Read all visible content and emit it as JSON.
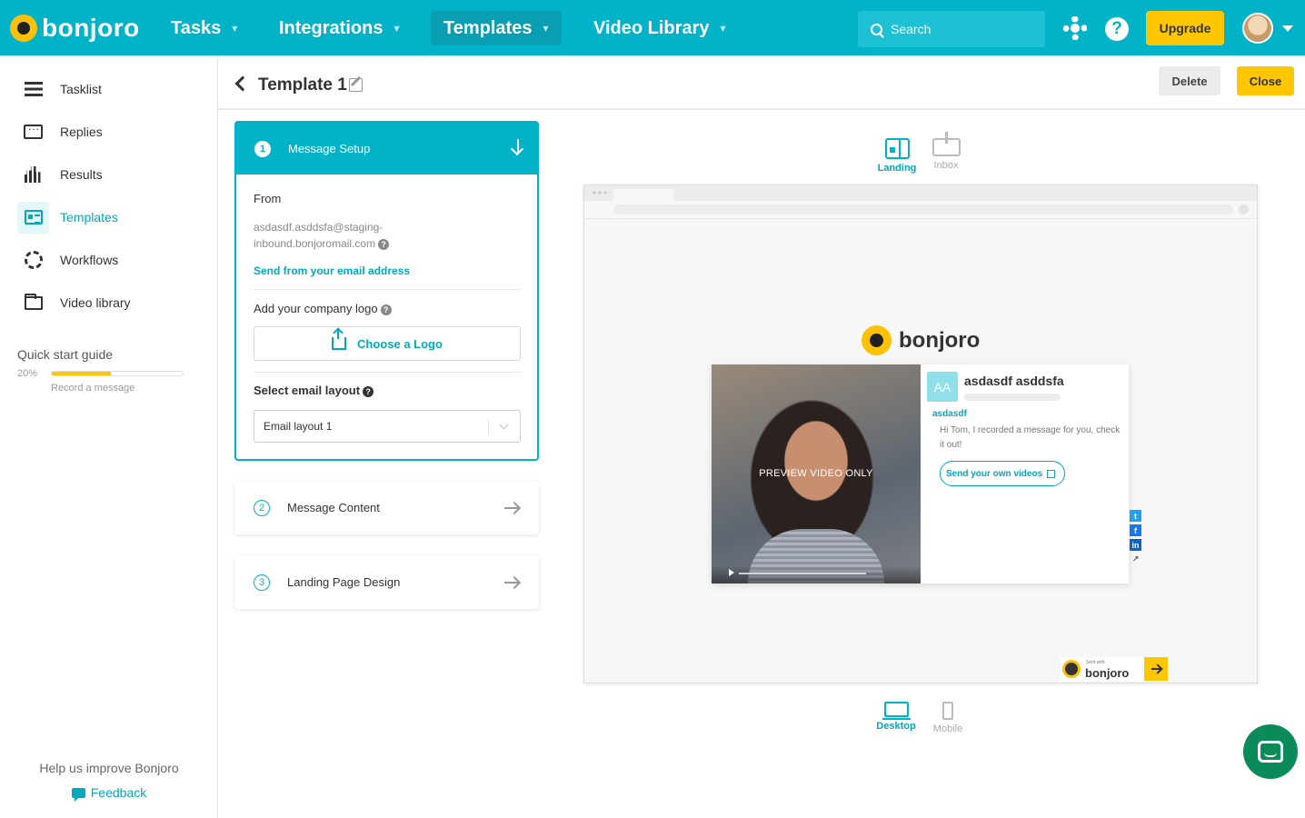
{
  "nav": {
    "brand": "bonjoro",
    "items": [
      {
        "label": "Tasks"
      },
      {
        "label": "Integrations"
      },
      {
        "label": "Templates"
      },
      {
        "label": "Video Library"
      }
    ],
    "active_item": "Templates",
    "search_placeholder": "Search",
    "upgrade_label": "Upgrade",
    "help_glyph": "?",
    "accent_color": "#00b3c9",
    "upgrade_color": "#ffc700"
  },
  "sidebar": {
    "items": [
      {
        "label": "Tasklist",
        "icon": "list-icon"
      },
      {
        "label": "Replies",
        "icon": "chat-bubble-icon"
      },
      {
        "label": "Results",
        "icon": "bar-chart-icon"
      },
      {
        "label": "Templates",
        "icon": "template-card-icon"
      },
      {
        "label": "Workflows",
        "icon": "cycle-icon"
      },
      {
        "label": "Video library",
        "icon": "folder-icon"
      }
    ],
    "active_item": "Templates",
    "quick_start": {
      "title": "Quick start guide",
      "percent_label": "20%",
      "progress": 0.45,
      "next_step": "Record a message"
    },
    "help_text": "Help us improve Bonjoro",
    "feedback_label": "Feedback"
  },
  "header": {
    "title": "Template 1",
    "delete_label": "Delete",
    "close_label": "Close"
  },
  "steps": {
    "step1": {
      "number": "1",
      "title": "Message Setup",
      "from_label": "From",
      "from_value_line1": "asdasdf.asddsfa@staging-",
      "from_value_line2": "inbound.bonjoromail.com",
      "send_from_link": "Send from your email address",
      "logo_label": "Add your company logo",
      "choose_logo_label": "Choose a Logo",
      "layout_label": "Select email layout",
      "layout_value": "Email layout 1",
      "help_glyph": "?"
    },
    "step2": {
      "number": "2",
      "title": "Message Content"
    },
    "step3": {
      "number": "3",
      "title": "Landing Page Design"
    }
  },
  "preview": {
    "view_tabs": [
      {
        "label": "Landing",
        "active": true
      },
      {
        "label": "Inbox",
        "active": false
      }
    ],
    "device_tabs": [
      {
        "label": "Desktop",
        "active": true
      },
      {
        "label": "Mobile",
        "active": false
      }
    ],
    "brand": "bonjoro",
    "video_label": "PREVIEW VIDEO ONLY",
    "avatar_initials": "AA",
    "sender_name": "asdasdf asddsfa",
    "message_from": "asdasdf",
    "message_body": "Hi Tom, I recorded a message for you, check it out!",
    "cta_label": "Send your own videos",
    "social": [
      {
        "name": "twitter-icon",
        "glyph": "t",
        "color": "#1da1f2"
      },
      {
        "name": "facebook-icon",
        "glyph": "f",
        "color": "#1877f2"
      },
      {
        "name": "linkedin-icon",
        "glyph": "in",
        "color": "#0a66c2"
      },
      {
        "name": "share-icon",
        "glyph": "↗",
        "color": "#555555"
      }
    ],
    "badge_small": "Sent with",
    "badge_brand": "bonjoro"
  }
}
